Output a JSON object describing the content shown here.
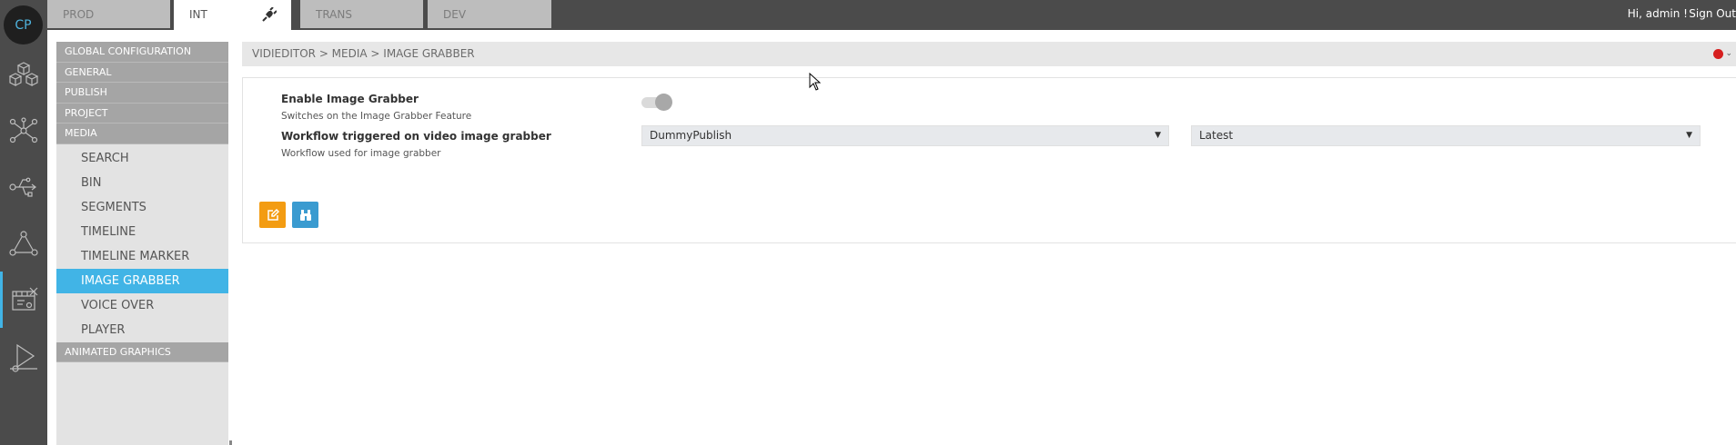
{
  "logo": {
    "text": "CP"
  },
  "env_tabs": [
    {
      "label": "PROD",
      "active": false
    },
    {
      "label": "INT",
      "active": true
    },
    {
      "label": "TRANS",
      "active": false
    },
    {
      "label": "DEV",
      "active": false
    }
  ],
  "user": {
    "greeting": "Hi, admin !",
    "sign_out": "Sign Out"
  },
  "rail_icons": [
    "cubes-icon",
    "network-icon",
    "usb-flow-icon",
    "triangle-network-icon",
    "video-editor-icon",
    "publish-triangle-icon"
  ],
  "sidebar": {
    "groups_top": [
      "GLOBAL CONFIGURATION",
      "GENERAL",
      "PUBLISH",
      "PROJECT",
      "MEDIA"
    ],
    "media_items": [
      "SEARCH",
      "BIN",
      "SEGMENTS",
      "TIMELINE",
      "TIMELINE MARKER",
      "IMAGE GRABBER",
      "VOICE OVER",
      "PLAYER"
    ],
    "active_item": "IMAGE GRABBER",
    "groups_bottom": [
      "ANIMATED GRAPHICS"
    ]
  },
  "breadcrumb": "VIDIEDITOR > MEDIA > IMAGE GRABBER",
  "settings": {
    "enable_label": "Enable Image Grabber",
    "enable_help": "Switches on the Image Grabber Feature",
    "enable_value": "on",
    "workflow_label": "Workflow triggered on video image grabber",
    "workflow_help": "Workflow used for image grabber",
    "workflow_value": "DummyPublish",
    "version_value": "Latest"
  },
  "colors": {
    "accent": "#41b4e6",
    "edit_button": "#f39c12",
    "find_button": "#3a9bd0",
    "alert": "#d61f1f"
  }
}
